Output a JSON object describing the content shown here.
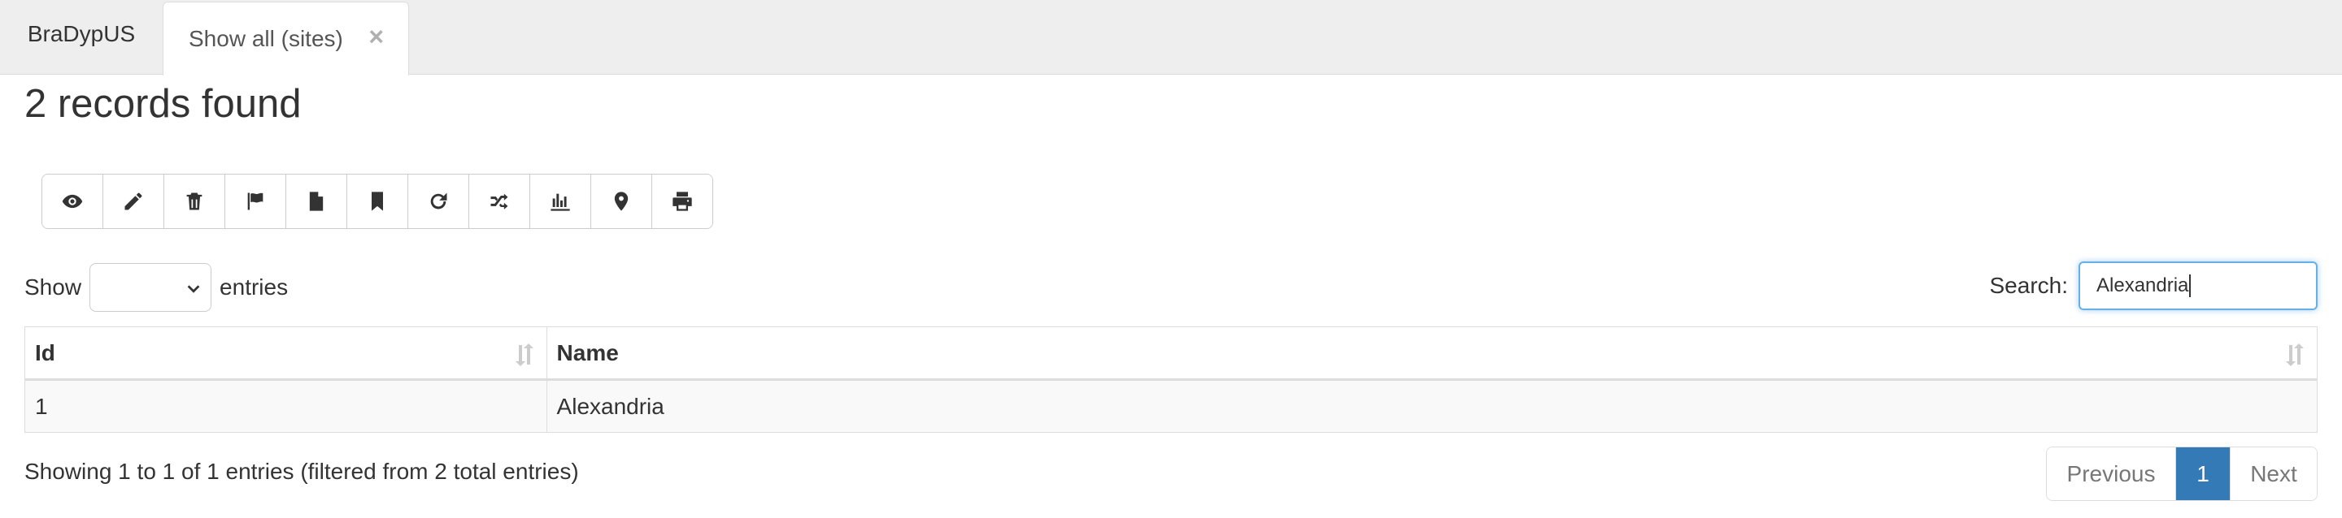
{
  "tabs": {
    "brand": "BraDypUS",
    "active": "Show all (sites)",
    "close_glyph": "×"
  },
  "title": "2 records found",
  "toolbar": {
    "buttons": [
      "eye-icon",
      "pencil-icon",
      "trash-icon",
      "flag-icon",
      "file-icon",
      "bookmark-icon",
      "refresh-icon",
      "shuffle-icon",
      "chart-icon",
      "map-marker-icon",
      "print-icon"
    ]
  },
  "length": {
    "show_label": "Show",
    "entries_label": "entries",
    "selected": ""
  },
  "search": {
    "label": "Search:",
    "value": "Alexandria"
  },
  "table": {
    "columns": [
      "Id",
      "Name"
    ],
    "rows": [
      [
        "1",
        "Alexandria"
      ]
    ]
  },
  "info": "Showing 1 to 1 of 1 entries (filtered from 2 total entries)",
  "pagination": {
    "previous": "Previous",
    "current": "1",
    "next": "Next"
  },
  "colors": {
    "accent": "#337ab7",
    "focus": "#66afe9"
  }
}
